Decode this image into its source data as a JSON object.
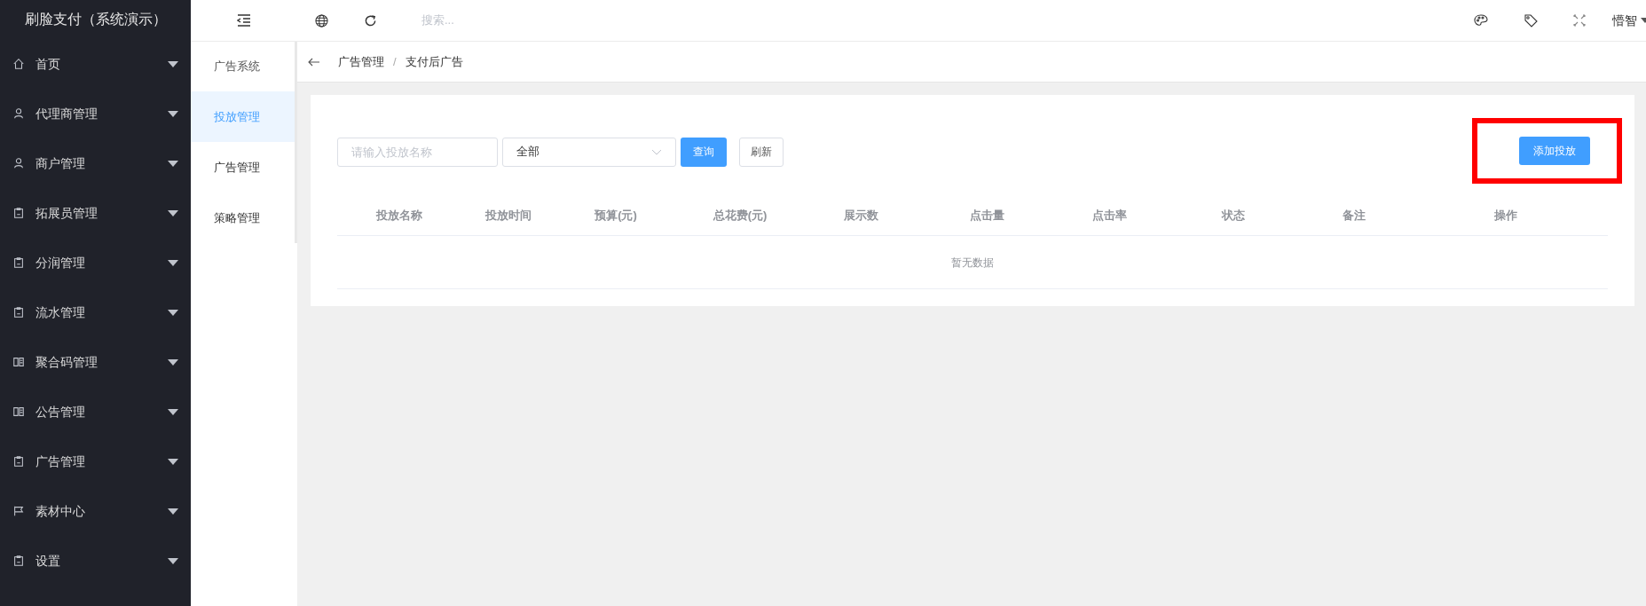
{
  "app_title": "刷脸支付（系统演示）",
  "sidebar": {
    "items": [
      {
        "label": "首页",
        "kind": "home"
      },
      {
        "label": "代理商管理",
        "kind": "user"
      },
      {
        "label": "商户管理",
        "kind": "user"
      },
      {
        "label": "拓展员管理",
        "kind": "clipboard"
      },
      {
        "label": "分润管理",
        "kind": "clipboard"
      },
      {
        "label": "流水管理",
        "kind": "clipboard"
      },
      {
        "label": "聚合码管理",
        "kind": "book"
      },
      {
        "label": "公告管理",
        "kind": "book"
      },
      {
        "label": "广告管理",
        "kind": "clipboard"
      },
      {
        "label": "素材中心",
        "kind": "flag"
      },
      {
        "label": "设置",
        "kind": "clipboard"
      }
    ]
  },
  "topbar": {
    "search": {
      "placeholder": "搜索..."
    },
    "user": "懵智"
  },
  "submenu": {
    "title": "广告系统",
    "items": [
      {
        "label": "投放管理",
        "selected": true
      },
      {
        "label": "广告管理",
        "selected": false
      },
      {
        "label": "策略管理",
        "selected": false
      }
    ]
  },
  "breadcrumb": [
    "广告管理",
    "支付后广告"
  ],
  "breadcrumb_separator": "/",
  "filters": {
    "name_field": {
      "placeholder": "请输入投放名称"
    },
    "status_select": {
      "value": "全部"
    },
    "query_button": "查询",
    "refresh_button": "刷新",
    "add_button": "添加投放"
  },
  "table": {
    "columns": [
      "投放名称",
      "投放时间",
      "预算(元)",
      "总花费(元)",
      "展示数",
      "点击量",
      "点击率",
      "状态",
      "备注",
      "操作"
    ],
    "empty_text": "暂无数据"
  }
}
